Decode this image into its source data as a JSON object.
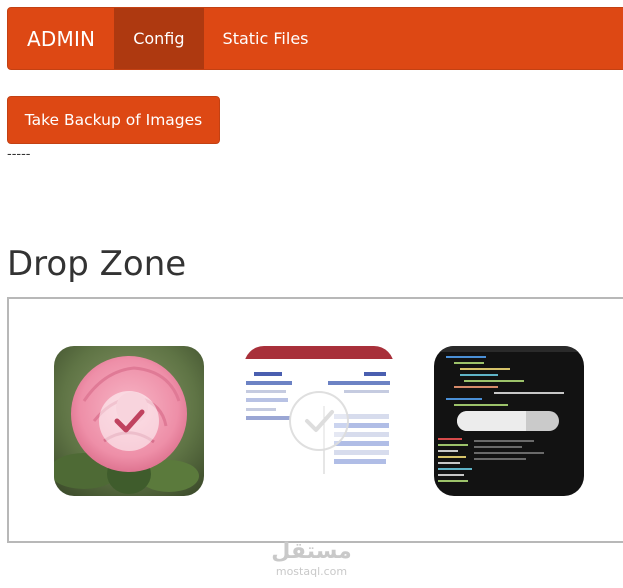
{
  "navbar": {
    "brand": "ADMIN",
    "items": [
      {
        "label": "Config",
        "active": true
      },
      {
        "label": "Static Files",
        "active": false
      }
    ],
    "color": "#dd4814",
    "active_color": "#ae3910"
  },
  "backup": {
    "label": "Take Backup of Images"
  },
  "separator_text": "-----",
  "dropzone": {
    "title": "Drop Zone",
    "files": [
      {
        "preview": "pink-rose-photo",
        "status": "success"
      },
      {
        "preview": "document-screenshot",
        "status": "success"
      },
      {
        "preview": "code-editor-screenshot",
        "status": "uploading",
        "progress": 0.68
      }
    ]
  },
  "watermark": {
    "arabic": "مستقل",
    "latin": "mostaql.com"
  }
}
